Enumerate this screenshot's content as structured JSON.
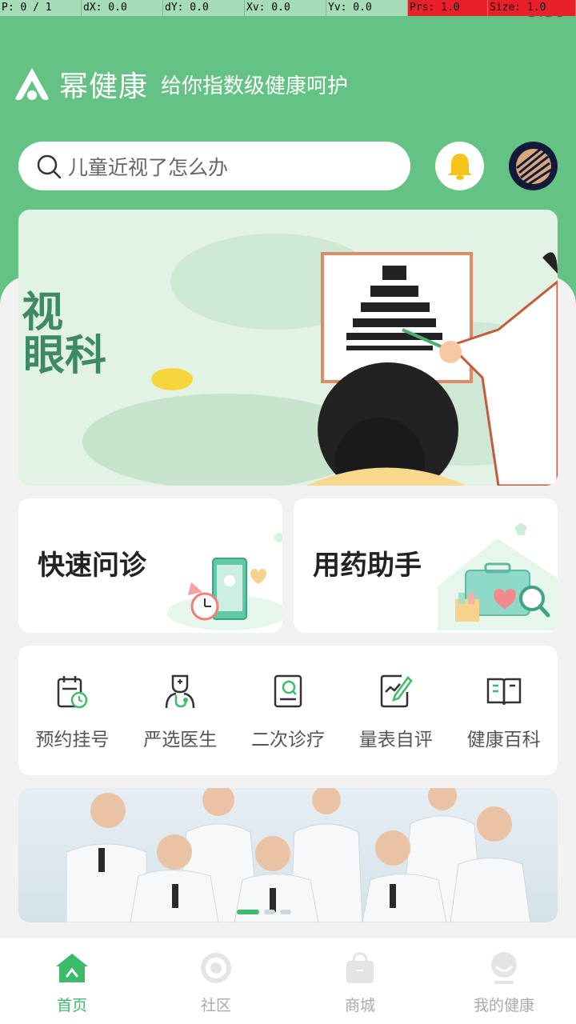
{
  "debug": [
    "P: 0 / 1",
    "dX: 0.0",
    "dY: 0.0",
    "Xv: 0.0",
    "Yv: 0.0",
    "Prs: 1.0",
    "Size: 1.0"
  ],
  "status": {
    "time": "5:59"
  },
  "brand": {
    "name": "幂健康",
    "slogan": "给你指数级健康呵护"
  },
  "search": {
    "placeholder": "儿童近视了怎么办"
  },
  "banner": {
    "line1": "视",
    "line2": "眼科"
  },
  "cards": {
    "consult": "快速问诊",
    "medicine": "用药助手"
  },
  "menu": [
    {
      "label": "预约挂号",
      "icon": "calendar-clock-icon"
    },
    {
      "label": "严选医生",
      "icon": "doctor-stethoscope-icon"
    },
    {
      "label": "二次诊疗",
      "icon": "report-search-icon"
    },
    {
      "label": "量表自评",
      "icon": "chart-pencil-icon"
    },
    {
      "label": "健康百科",
      "icon": "open-book-icon"
    }
  ],
  "tabs": [
    {
      "label": "首页",
      "icon": "home-icon",
      "active": true
    },
    {
      "label": "社区",
      "icon": "community-icon",
      "active": false
    },
    {
      "label": "商城",
      "icon": "shopping-bag-icon",
      "active": false
    },
    {
      "label": "我的健康",
      "icon": "profile-icon",
      "active": false
    }
  ],
  "colors": {
    "primary": "#64c384",
    "accent": "#3dbb6b",
    "bell": "#f7c21c"
  }
}
